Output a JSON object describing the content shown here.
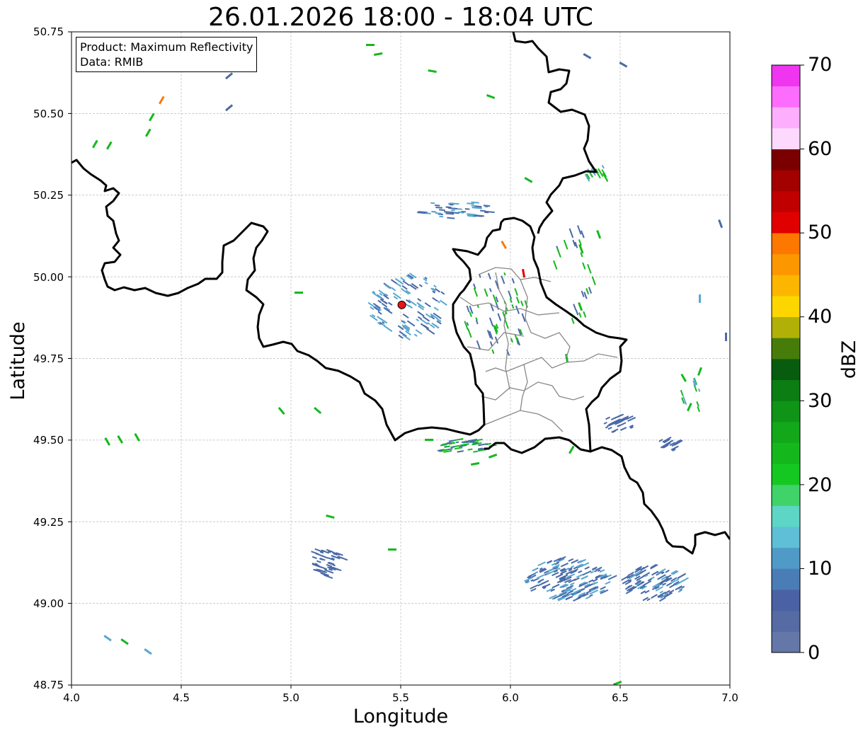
{
  "title": "26.01.2026 18:00 - 18:04 UTC",
  "xlabel": "Longitude",
  "ylabel": "Latitude",
  "info": {
    "product": "Product: Maximum Reflectivity",
    "data": "Data: RMIB"
  },
  "xticks": [
    "4.0",
    "4.5",
    "5.0",
    "5.5",
    "6.0",
    "6.5",
    "7.0"
  ],
  "yticks": [
    "48.75",
    "49.00",
    "49.25",
    "49.50",
    "49.75",
    "50.00",
    "50.25",
    "50.50",
    "50.75"
  ],
  "xlim": [
    4.0,
    7.0
  ],
  "ylim": [
    48.75,
    50.75
  ],
  "grid": true,
  "radar_site": {
    "lon": 5.505,
    "lat": 49.914,
    "color": "#e8141b"
  },
  "colorbar": {
    "label": "dBZ",
    "range": [
      0,
      70
    ],
    "ticks": [
      "0",
      "10",
      "20",
      "30",
      "40",
      "50",
      "60",
      "70"
    ],
    "colors": [
      "#6577a8",
      "#566aa4",
      "#4a61a3",
      "#4a7db5",
      "#4f9ac6",
      "#5fbfd6",
      "#5dd6c5",
      "#3fd36a",
      "#14c821",
      "#14b81d",
      "#12a81a",
      "#0f9417",
      "#0b7d13",
      "#075c0e",
      "#477c0a",
      "#b0b006",
      "#fdd600",
      "#fdb600",
      "#fd9700",
      "#fd7800",
      "#e10000",
      "#c00000",
      "#a30000",
      "#7a0000",
      "#fdd9fd",
      "#fdaefd",
      "#fd6dfd",
      "#ef35ef"
    ]
  },
  "echo_colors": {
    "weak": "#4a6aa8",
    "light": "#5aa8d0",
    "moderate": "#14b81d",
    "strong": "#fd7800",
    "intense": "#e10000"
  }
}
